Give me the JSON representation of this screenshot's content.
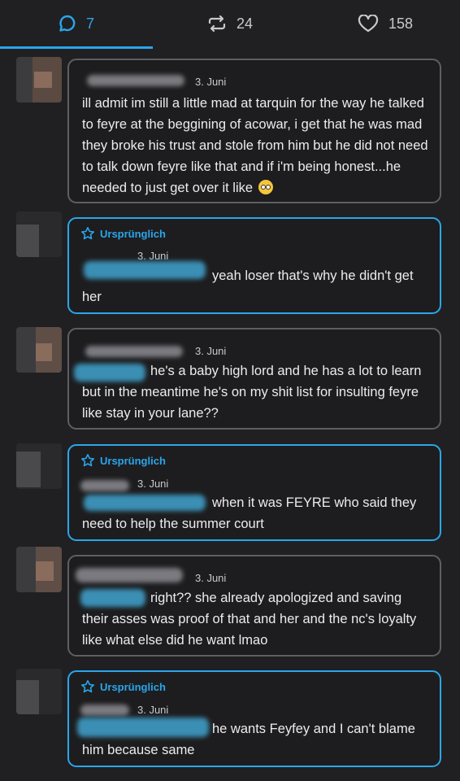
{
  "tabs": {
    "replies": {
      "count": "7",
      "icon": "reply-bubble-icon"
    },
    "reblogs": {
      "count": "24",
      "icon": "reblog-icon"
    },
    "likes": {
      "count": "158",
      "icon": "heart-icon"
    }
  },
  "accent_color": "#2aa6ea",
  "original_label": "Ursprünglich",
  "comments": [
    {
      "date": "3. Juni",
      "text": "ill admit im still a little mad at tarquin for the way he talked to feyre at the beggining of acowar, i get that he was mad they broke his trust and stole from him but he did not need to talk down feyre like that and if i'm being honest...he needed to just get over it like",
      "emoji": "eye-roll-emoji",
      "original": false
    },
    {
      "date": "3. Juni",
      "text": "yeah loser that's why he didn't get her",
      "original": true
    },
    {
      "date": "3. Juni",
      "text": "he's a baby high lord and he has a lot to learn but in the meantime he's on my shit list for insulting feyre like stay in your lane??",
      "original": false
    },
    {
      "date": "3. Juni",
      "text": "when it was FEYRE who said they need to help the summer court",
      "original": true
    },
    {
      "date": "3. Juni",
      "text": "right?? she already apologized and saving their asses was proof of that and her and the nc's loyalty like what else did he want lmao",
      "original": false
    },
    {
      "date": "3. Juni",
      "text": "he wants Feyfey and I can't blame him because same",
      "original": true
    }
  ]
}
